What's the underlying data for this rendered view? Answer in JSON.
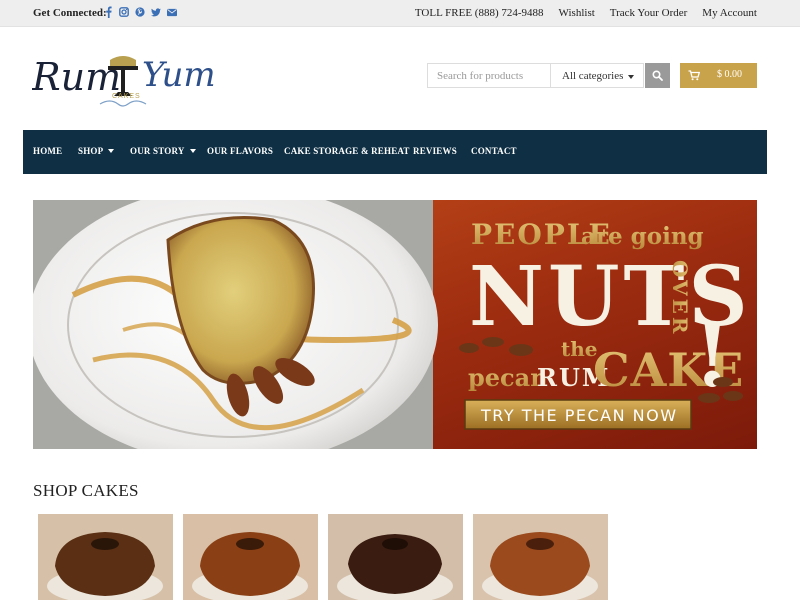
{
  "topbar": {
    "get_connected": "Get Connected:",
    "social_icons": [
      "facebook-icon",
      "instagram-icon",
      "pinterest-icon",
      "twitter-icon",
      "email-icon"
    ],
    "toll_free": "TOLL FREE (888) 724-9488",
    "wishlist": "Wishlist",
    "track_order": "Track Your Order",
    "my_account": "My Account"
  },
  "logo": {
    "word1": "Rum",
    "word2": "Yum",
    "tag": "CAKES"
  },
  "search": {
    "placeholder": "Search for products",
    "category": "All categories"
  },
  "cart": {
    "amount": "$ 0.00"
  },
  "nav": {
    "items": [
      {
        "label": "HOME"
      },
      {
        "label": "SHOP"
      },
      {
        "label": "OUR STORY"
      },
      {
        "label": "OUR FLAVORS"
      },
      {
        "label": "CAKE STORAGE & REHEAT"
      },
      {
        "label": "REVIEWS"
      },
      {
        "label": "CONTACT"
      }
    ]
  },
  "banner": {
    "line1a": "PEOPLE",
    "line1b": "are going",
    "nuts": "NUTS",
    "over": "OVER",
    "the": "the",
    "pecan": "pecan",
    "rum": "RUM",
    "cake": "CAKE",
    "exclaim": "!",
    "cta": "TRY THE PECAN NOW"
  },
  "shop": {
    "title": "SHOP CAKES"
  },
  "colors": {
    "nav_bg": "#0e2f44",
    "accent_gold": "#c9a34b",
    "banner_red": "#9b2c10"
  }
}
